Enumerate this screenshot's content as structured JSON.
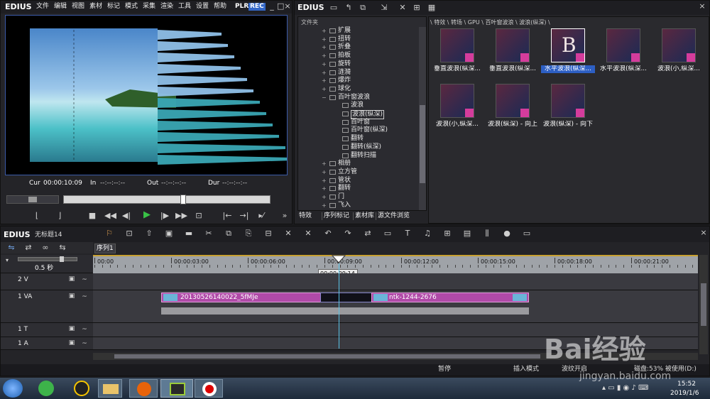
{
  "player": {
    "app": "EDIUS",
    "menu": [
      "文件",
      "编辑",
      "视图",
      "素材",
      "标记",
      "模式",
      "采集",
      "渲染",
      "工具",
      "设置",
      "帮助"
    ],
    "plr": "PLR",
    "rec": "REC",
    "cur_label": "Cur",
    "cur_value": "00:00:10:09",
    "in_label": "In",
    "in_value": "--:--:--:--",
    "out_label": "Out",
    "out_value": "--:--:--:--",
    "dur_label": "Dur",
    "dur_value": "--:--:--:--"
  },
  "bin": {
    "app": "EDIUS",
    "folder_header": "文件夹",
    "path": "\\ 特效 \\ 转场 \\ GPU \\ 百叶窗波浪 \\ 波浪(纵深) \\",
    "tree": [
      {
        "label": "扩展",
        "level": 1,
        "open": false,
        "sel": false
      },
      {
        "label": "扭转",
        "level": 1,
        "open": false,
        "sel": false
      },
      {
        "label": "折叠",
        "level": 1,
        "open": false,
        "sel": false
      },
      {
        "label": "拍板",
        "level": 1,
        "open": false,
        "sel": false
      },
      {
        "label": "旋转",
        "level": 1,
        "open": false,
        "sel": false
      },
      {
        "label": "涟漪",
        "level": 1,
        "open": false,
        "sel": false
      },
      {
        "label": "爆炸",
        "level": 1,
        "open": false,
        "sel": false
      },
      {
        "label": "球化",
        "level": 1,
        "open": false,
        "sel": false
      },
      {
        "label": "百叶窗波浪",
        "level": 1,
        "open": true,
        "sel": false
      },
      {
        "label": "波浪",
        "level": 2,
        "open": false,
        "sel": false
      },
      {
        "label": "波浪(纵深)",
        "level": 2,
        "open": false,
        "sel": true
      },
      {
        "label": "百叶窗",
        "level": 2,
        "open": false,
        "sel": false
      },
      {
        "label": "百叶窗(纵深)",
        "level": 2,
        "open": false,
        "sel": false
      },
      {
        "label": "翻转",
        "level": 2,
        "open": false,
        "sel": false
      },
      {
        "label": "翻转(纵深)",
        "level": 2,
        "open": false,
        "sel": false
      },
      {
        "label": "翻转扫描",
        "level": 2,
        "open": false,
        "sel": false
      },
      {
        "label": "相册",
        "level": 1,
        "open": false,
        "sel": false
      },
      {
        "label": "立方管",
        "level": 1,
        "open": false,
        "sel": false
      },
      {
        "label": "管状",
        "level": 1,
        "open": false,
        "sel": false
      },
      {
        "label": "翻转",
        "level": 1,
        "open": false,
        "sel": false
      },
      {
        "label": "门",
        "level": 1,
        "open": false,
        "sel": false
      },
      {
        "label": "飞入",
        "level": 1,
        "open": false,
        "sel": false
      }
    ],
    "tabs": [
      "特效",
      "序列标记",
      "素材库",
      "源文件浏览"
    ],
    "items": [
      {
        "label": "垂直波浪(纵深...",
        "glyph": "",
        "sel": false
      },
      {
        "label": "垂直波浪(纵深...",
        "glyph": "",
        "sel": false
      },
      {
        "label": "水平波浪(纵深...",
        "glyph": "B",
        "sel": true
      },
      {
        "label": "水平波浪(纵深...",
        "glyph": "",
        "sel": false
      },
      {
        "label": "波浪(小,纵深...",
        "glyph": "",
        "sel": false
      },
      {
        "label": "波浪(小,纵深...",
        "glyph": "",
        "sel": false
      },
      {
        "label": "波浪(纵深) - 向上",
        "glyph": "",
        "sel": false
      },
      {
        "label": "波浪(纵深) - 向下",
        "glyph": "",
        "sel": false
      }
    ]
  },
  "timeline": {
    "app": "EDIUS",
    "project": "无标题14",
    "sequence_tab": "序列1",
    "zoom": "0.5 秒",
    "ruler": [
      "00:00",
      "00:00:03:00",
      "00:00:06:00",
      "00:00:09:00",
      "00:00:12:00",
      "00:00:15:00",
      "00:00:18:00",
      "00:00:21:00"
    ],
    "playhead_tc": "00:00:09:14",
    "tracks": [
      {
        "name": "2 V",
        "kind": "v"
      },
      {
        "name": "1 VA",
        "kind": "va"
      },
      {
        "name": "1 T",
        "kind": "t"
      },
      {
        "name": "1 A",
        "kind": "a"
      }
    ],
    "clip1": "20130526140022_5fMJe",
    "clip2": "ntk-1244-2676",
    "status": [
      "暂停",
      "插入模式",
      "波纹开启",
      "磁盘:53% 被使用(D:)"
    ]
  },
  "taskbar": {
    "time": "15:52",
    "date": "2019/1/6",
    "watermark": "Bai经验",
    "watermark_url": "jingyan.baidu.com"
  }
}
